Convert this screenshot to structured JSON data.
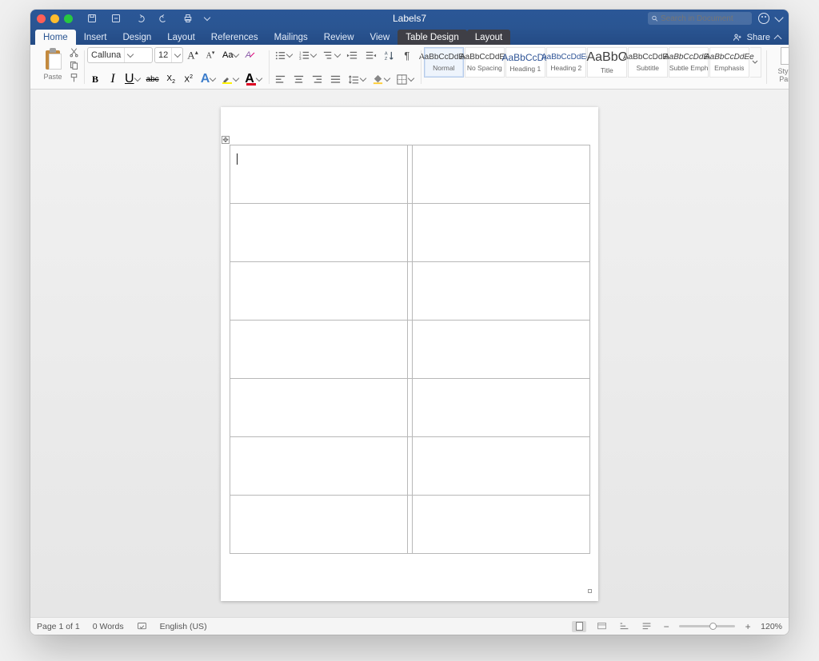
{
  "window": {
    "title": "Labels7"
  },
  "search": {
    "placeholder": "Search in Document"
  },
  "share": {
    "label": "Share"
  },
  "tabs": {
    "items": [
      {
        "label": "Home",
        "state": "active"
      },
      {
        "label": "Insert"
      },
      {
        "label": "Design"
      },
      {
        "label": "Layout"
      },
      {
        "label": "References"
      },
      {
        "label": "Mailings"
      },
      {
        "label": "Review"
      },
      {
        "label": "View"
      },
      {
        "label": "Table Design",
        "context": true
      },
      {
        "label": "Layout",
        "context": true
      }
    ]
  },
  "ribbon": {
    "clipboard": {
      "paste_label": "Paste"
    },
    "font": {
      "name": "Calluna",
      "size": "12"
    },
    "styles": {
      "items": [
        {
          "preview": "AaBbCcDdEe",
          "label": "Normal",
          "selected": true,
          "cls": ""
        },
        {
          "preview": "AaBbCcDdEe",
          "label": "No Spacing",
          "cls": ""
        },
        {
          "preview": "AaBbCcDc",
          "label": "Heading 1",
          "cls": "md bl"
        },
        {
          "preview": "AaBbCcDdEe",
          "label": "Heading 2",
          "cls": "bl"
        },
        {
          "preview": "AaBbC",
          "label": "Title",
          "cls": "lg"
        },
        {
          "preview": "AaBbCcDdEe",
          "label": "Subtitle",
          "cls": ""
        },
        {
          "preview": "AaBbCcDdEe",
          "label": "Subtle Emph...",
          "cls": "it"
        },
        {
          "preview": "AaBbCcDdEe",
          "label": "Emphasis",
          "cls": "it"
        }
      ],
      "pane_label": "Styles\nPane"
    }
  },
  "statusbar": {
    "page": "Page 1 of 1",
    "words": "0 Words",
    "lang": "English (US)",
    "zoom": "120%"
  }
}
